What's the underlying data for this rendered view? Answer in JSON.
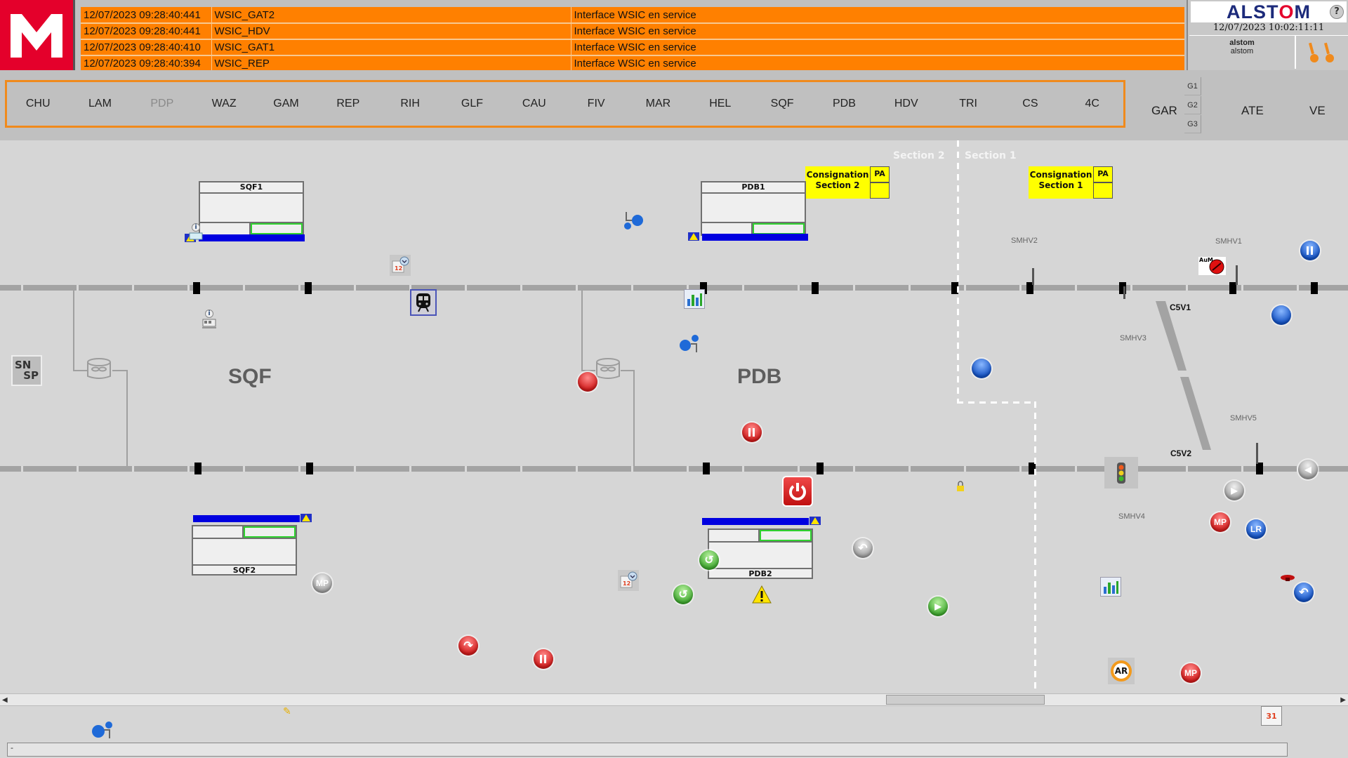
{
  "logo": {
    "letter": "M",
    "brand_color": "#e4002b"
  },
  "alarms": [
    {
      "timestamp": "12/07/2023 09:28:40:441",
      "source": "WSIC_GAT2",
      "message": "Interface WSIC en service"
    },
    {
      "timestamp": "12/07/2023 09:28:40:441",
      "source": "WSIC_HDV",
      "message": "Interface WSIC en service"
    },
    {
      "timestamp": "12/07/2023 09:28:40:410",
      "source": "WSIC_GAT1",
      "message": "Interface WSIC en service"
    },
    {
      "timestamp": "12/07/2023 09:28:40:394",
      "source": "WSIC_REP",
      "message": "Interface WSIC en service"
    }
  ],
  "header": {
    "brand_pre": "ALST",
    "brand_o": "O",
    "brand_post": "M",
    "help_label": "?",
    "datetime": "12/07/2023 10:02:11:11",
    "user_name": "alstom",
    "user_role": "alstom",
    "keys_icon": "key-icon"
  },
  "nav": {
    "stations": [
      {
        "label": "CHU",
        "enabled": true
      },
      {
        "label": "LAM",
        "enabled": true
      },
      {
        "label": "PDP",
        "enabled": false
      },
      {
        "label": "WAZ",
        "enabled": true
      },
      {
        "label": "GAM",
        "enabled": true
      },
      {
        "label": "REP",
        "enabled": true
      },
      {
        "label": "RIH",
        "enabled": true
      },
      {
        "label": "GLF",
        "enabled": true
      },
      {
        "label": "CAU",
        "enabled": true
      },
      {
        "label": "FIV",
        "enabled": true
      },
      {
        "label": "MAR",
        "enabled": true
      },
      {
        "label": "HEL",
        "enabled": true
      },
      {
        "label": "SQF",
        "enabled": true
      },
      {
        "label": "PDB",
        "enabled": true
      },
      {
        "label": "HDV",
        "enabled": true
      },
      {
        "label": "TRI",
        "enabled": true
      },
      {
        "label": "CS",
        "enabled": true
      },
      {
        "label": "4C",
        "enabled": true
      }
    ],
    "gar": "GAR",
    "groups": [
      "G1",
      "G2",
      "G3"
    ],
    "ate": "ATE",
    "ve": "VE",
    "frame_color": "#f08a1c"
  },
  "synoptic": {
    "sectors": [
      "SQF",
      "PDB"
    ],
    "platforms": {
      "sqf1": "SQF1",
      "sqf2": "SQF2",
      "pdb1": "PDB1",
      "pdb2": "PDB2"
    },
    "sections": {
      "s2": "Section 2",
      "s1": "Section 1"
    },
    "consignation": [
      {
        "line1": "Consignation",
        "line2": "Section 2",
        "pa": "PA"
      },
      {
        "line1": "Consignation",
        "line2": "Section 1",
        "pa": "PA"
      }
    ],
    "switch_labels": {
      "smhv1": "SMHV1",
      "smhv2": "SMHV2",
      "smhv3": "SMHV3",
      "smhv4": "SMHV4",
      "smhv5": "SMHV5",
      "c5v1": "C5V1",
      "c5v2": "C5V2"
    },
    "snsp": {
      "top": "SN",
      "bottom": "SP"
    },
    "aum_label": "AuM",
    "btn_labels": {
      "mp": "MP",
      "lr": "LR",
      "ar": "AR",
      "cal31": "31"
    }
  },
  "statusline": {
    "text": "-"
  }
}
